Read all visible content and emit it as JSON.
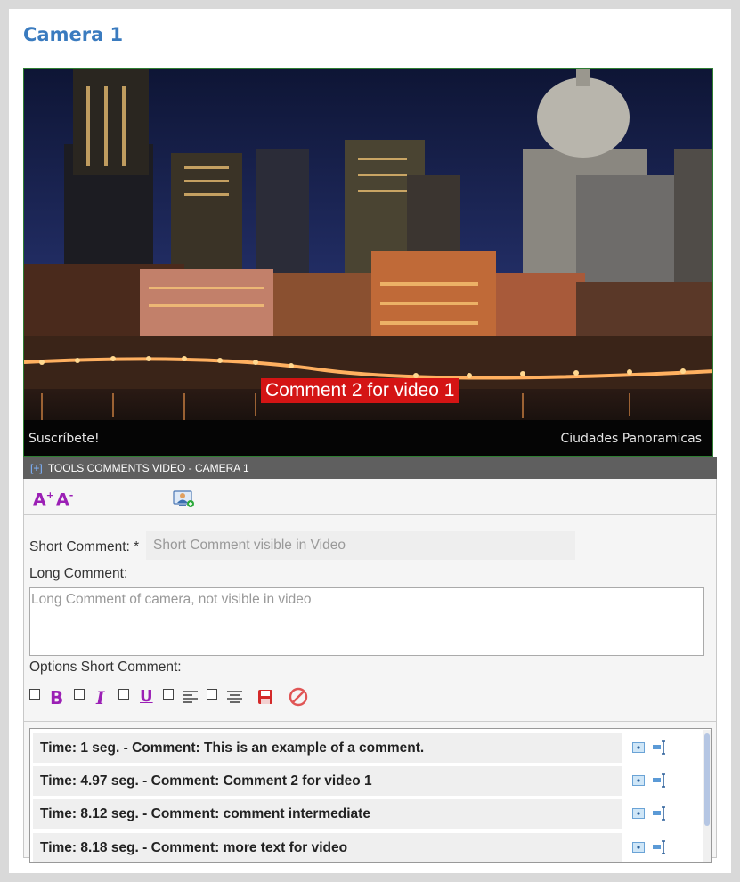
{
  "page": {
    "title": "Camera 1"
  },
  "video": {
    "overlay_comment": "Comment 2 for video 1",
    "watermark_left": "Suscríbete!",
    "watermark_right": "Ciudades Panoramicas"
  },
  "tools": {
    "toggle": "[+]",
    "title": "TOOLS COMMENTS VIDEO - CAMERA 1",
    "font_increase": "A",
    "font_increase_sign": "+",
    "font_decrease": "A",
    "font_decrease_sign": "-",
    "camera_icon": "add-camera-icon"
  },
  "form": {
    "short_label": "Short Comment: *",
    "short_placeholder": "Short Comment visible in Video",
    "long_label": "Long Comment:",
    "long_placeholder": "Long Comment of camera, not visible in video",
    "options_label": "Options Short Comment:",
    "bold": "B",
    "italic": "I",
    "underline": "U",
    "colors": {
      "accent": "#9b1fb5",
      "title": "#3a7bbf",
      "overlay": "#d41414"
    }
  },
  "comments": [
    "Time: 1 seg. - Comment: This is an example of a comment.",
    "Time: 4.97 seg. - Comment: Comment 2 for video 1",
    "Time: 8.12 seg. - Comment: comment intermediate",
    "Time: 8.18 seg. - Comment: more text for video"
  ]
}
